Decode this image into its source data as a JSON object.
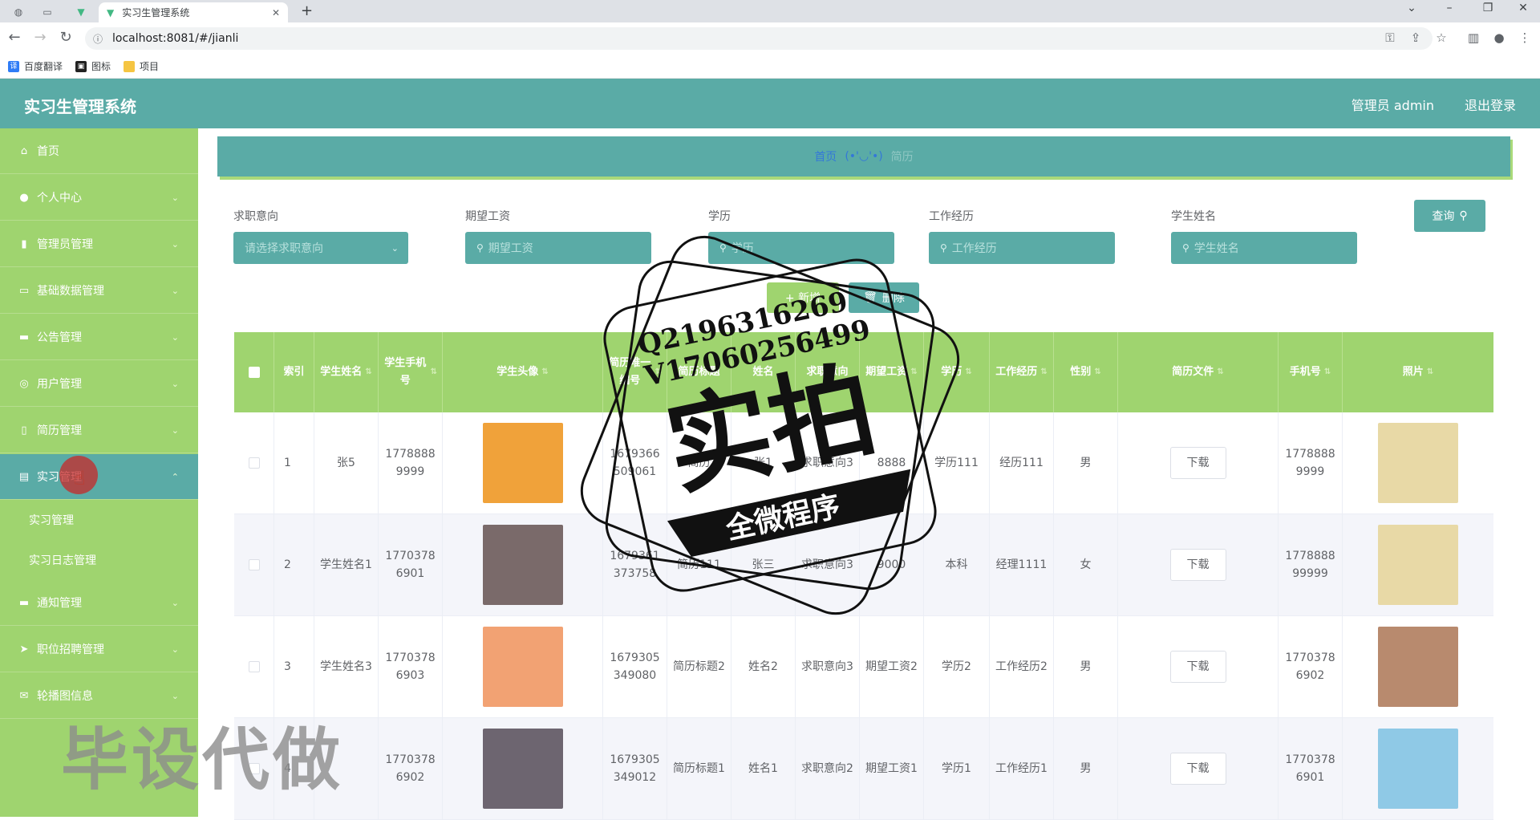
{
  "browser": {
    "tab_title": "实习生管理系统",
    "url": "localhost:8081/#/jianli",
    "bookmarks": [
      "百度翻译",
      "图标",
      "项目"
    ]
  },
  "header": {
    "title": "实习生管理系统",
    "user": "管理员 admin",
    "logout": "退出登录"
  },
  "sidebar": {
    "items": [
      {
        "label": "首页",
        "icon": "home-icon"
      },
      {
        "label": "个人中心",
        "icon": "user-icon"
      },
      {
        "label": "管理员管理",
        "icon": "chart-icon"
      },
      {
        "label": "基础数据管理",
        "icon": "card-icon"
      },
      {
        "label": "公告管理",
        "icon": "bell-icon"
      },
      {
        "label": "用户管理",
        "icon": "users-icon"
      },
      {
        "label": "简历管理",
        "icon": "phone-icon"
      },
      {
        "label": "实习管理",
        "icon": "folder-icon"
      },
      {
        "label": "通知管理",
        "icon": "notice-icon"
      },
      {
        "label": "职位招聘管理",
        "icon": "send-icon"
      },
      {
        "label": "轮播图信息",
        "icon": "mail-icon"
      }
    ],
    "sub_items": [
      "实习管理",
      "实习日志管理"
    ]
  },
  "breadcrumb": {
    "home": "首页",
    "separator": "(•'◡'•)",
    "current": "简历"
  },
  "search": {
    "labels": [
      "求职意向",
      "期望工资",
      "学历",
      "工作经历",
      "学生姓名"
    ],
    "select_placeholder": "请选择求职意向",
    "placeholders": [
      "期望工资",
      "学历",
      "工作经历",
      "学生姓名"
    ],
    "query_button": "查询"
  },
  "actions": {
    "add": "+ 新增",
    "delete": "删除"
  },
  "table": {
    "headers": [
      "索引",
      "学生姓名",
      "学生手机号",
      "学生头像",
      "简历唯一编号",
      "简历标题",
      "姓名",
      "求职意向",
      "期望工资",
      "学历",
      "工作经历",
      "性别",
      "简历文件",
      "手机号",
      "照片"
    ],
    "rows": [
      {
        "idx": "1",
        "sname": "张5",
        "sphone": "17788889999",
        "uid": "1679366509061",
        "title": "简历",
        "name": "张1",
        "intent": "求职意向3",
        "salary": "8888",
        "edu": "学历111",
        "exp": "经历111",
        "gender": "男",
        "file": "下载",
        "phone": "17788889999",
        "avatar_color": "#f0a23a",
        "photo_color": "#e8d9a6"
      },
      {
        "idx": "2",
        "sname": "学生姓名1",
        "sphone": "17703786901",
        "uid": "1679361373758",
        "title": "简历111",
        "name": "张三",
        "intent": "求职意向3",
        "salary": "9000",
        "edu": "本科",
        "exp": "经理1111",
        "gender": "女",
        "file": "下载",
        "phone": "177888899999",
        "avatar_color": "#7a6a6a",
        "photo_color": "#e8d9a6"
      },
      {
        "idx": "3",
        "sname": "学生姓名3",
        "sphone": "17703786903",
        "uid": "1679305349080",
        "title": "简历标题2",
        "name": "姓名2",
        "intent": "求职意向3",
        "salary": "期望工资2",
        "edu": "学历2",
        "exp": "工作经历2",
        "gender": "男",
        "file": "下载",
        "phone": "17703786902",
        "avatar_color": "#f2a273",
        "photo_color": "#b88a6e"
      },
      {
        "idx": "4",
        "sname": "",
        "sphone": "17703786902",
        "uid": "1679305349012",
        "title": "简历标题1",
        "name": "姓名1",
        "intent": "求职意向2",
        "salary": "期望工资1",
        "edu": "学历1",
        "exp": "工作经历1",
        "gender": "男",
        "file": "下载",
        "phone": "17703786901",
        "avatar_color": "#6d6570",
        "photo_color": "#8fc9e6"
      }
    ]
  },
  "overlays": {
    "stamp_line1": "Q2196316269",
    "stamp_line2": "V17060256499",
    "stamp_main": "实拍",
    "stamp_banner": "全微程序",
    "side_watermark": "毕设代做"
  }
}
